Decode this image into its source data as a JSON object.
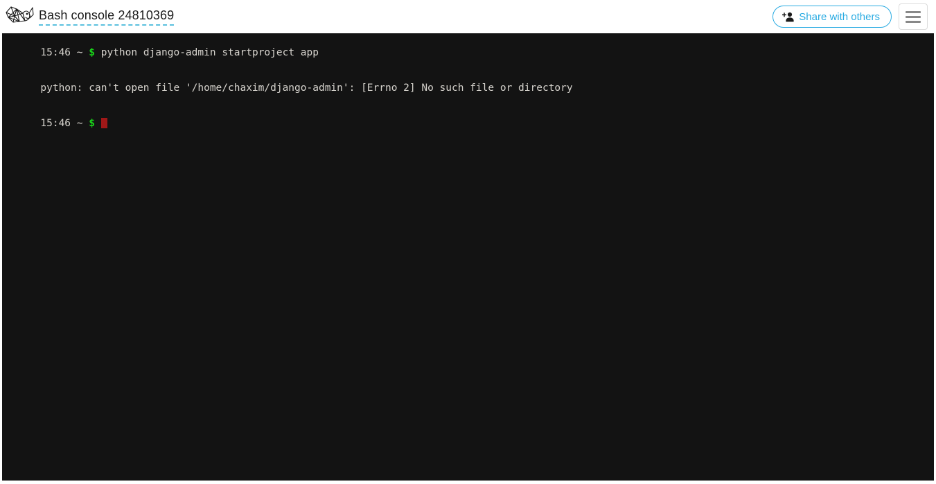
{
  "header": {
    "logo_icon": "pythonanywhere-whale-logo",
    "console_title": "Bash console 24810369",
    "share_button": {
      "label": "Share with others",
      "icon": "add-person-icon",
      "accent_color": "#29abe2"
    },
    "menu_button": {
      "icon": "hamburger-menu-icon"
    }
  },
  "terminal": {
    "background_color": "#131313",
    "text_color": "#d6d3cd",
    "prompt_symbol_color": "#19d419",
    "cursor_color": "#a01818",
    "lines": [
      {
        "type": "prompt",
        "time": "15:46",
        "cwd": "~",
        "symbol": "$",
        "command": "python django-admin startproject app"
      },
      {
        "type": "output",
        "text": "python: can't open file '/home/chaxim/django-admin': [Errno 2] No such file or directory"
      },
      {
        "type": "prompt",
        "time": "15:46",
        "cwd": "~",
        "symbol": "$",
        "command": ""
      }
    ]
  }
}
